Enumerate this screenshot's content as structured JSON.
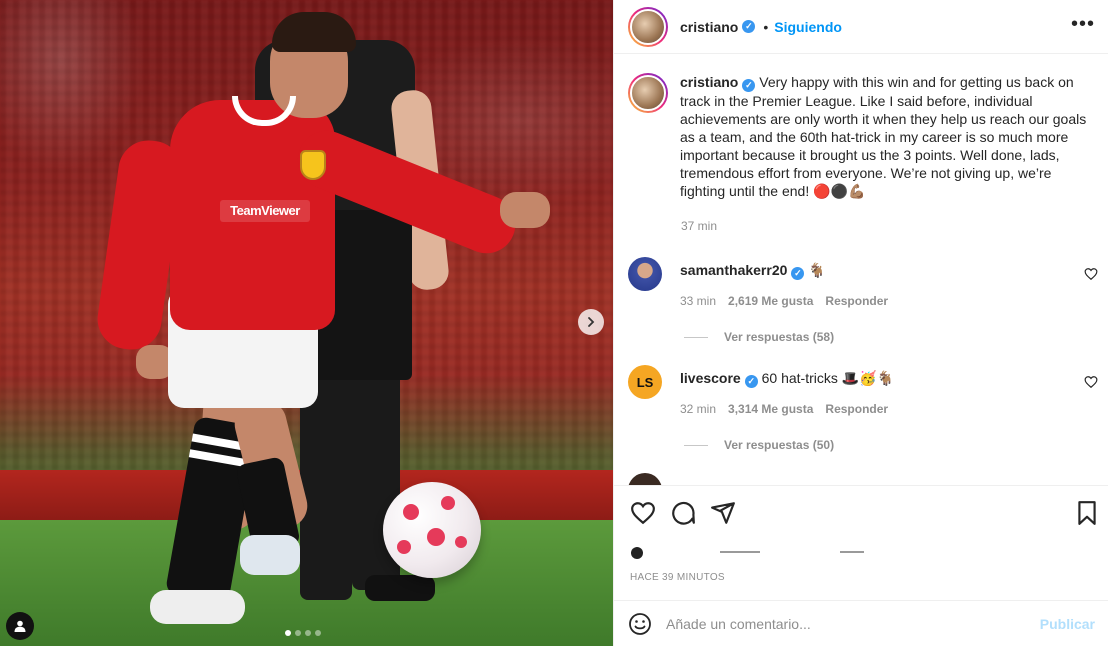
{
  "post": {
    "username": "cristiano",
    "follow_label": "Siguiendo",
    "separator": "•",
    "more_label": "•••",
    "caption_text": "Very happy with this win and for getting us back on track in the Premier League. Like I said before, individual achievements are only worth it when they help us reach our goals as a team, and the 60th hat-trick in my career is so much more important because it brought us the 3 points. Well done, lads, tremendous effort from everyone. We’re not giving up, we’re fighting until the end! 🔴⚫💪🏽",
    "caption_time": "37 min",
    "posted_label": "HACE 39 MINUTOS",
    "media": {
      "sponsor_text": "TeamViewer",
      "slide_count": 4,
      "active_slide": 1
    }
  },
  "comments": [
    {
      "username": "samanthakerr20",
      "text": "🐐",
      "time": "33 min",
      "likes": "2,619 Me gusta",
      "reply_label": "Responder",
      "view_replies": "Ver respuestas (58)"
    },
    {
      "username": "livescore",
      "text": "60 hat-tricks 🎩🥳🐐",
      "time": "32 min",
      "likes": "3,314 Me gusta",
      "reply_label": "Responder",
      "view_replies": "Ver respuestas (50)",
      "avatar_text": "LS"
    }
  ],
  "composer": {
    "placeholder": "Añade un comentario...",
    "publish_label": "Publicar"
  },
  "colors": {
    "accent": "#0095f6",
    "verified": "#3897f0",
    "muted": "#8e8e8e",
    "publish_disabled": "#b2dffc"
  }
}
